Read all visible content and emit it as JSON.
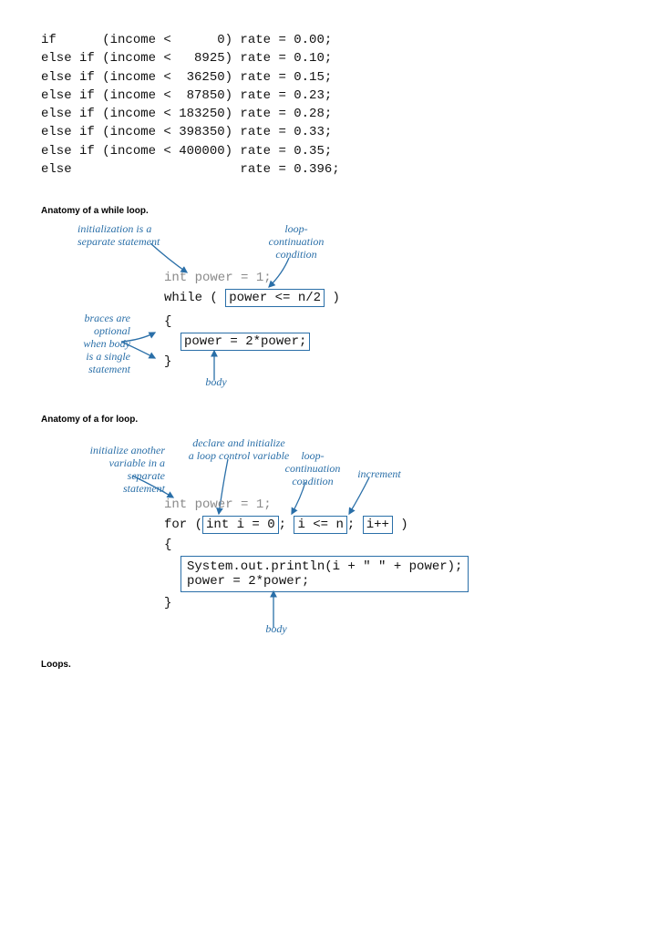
{
  "code_block": "if      (income <      0) rate = 0.00;\nelse if (income <   8925) rate = 0.10;\nelse if (income <  36250) rate = 0.15;\nelse if (income <  87850) rate = 0.23;\nelse if (income < 183250) rate = 0.28;\nelse if (income < 398350) rate = 0.33;\nelse if (income < 400000) rate = 0.35;\nelse                      rate = 0.396;",
  "captions": {
    "while": "Anatomy of a while loop.",
    "for": "Anatomy of a for loop.",
    "loops": "Loops."
  },
  "while": {
    "annot_init": "initialization is a\nseparate statement",
    "annot_cond": "loop-\ncontinuation\ncondition",
    "annot_braces": "braces are\noptional\nwhen body\nis a single\nstatement",
    "annot_body": "body",
    "gray_line": "int power = 1;",
    "head_left": "while ( ",
    "cond": "power <= n/2",
    "head_right": " )",
    "brace_open": "{",
    "body_stmt": "power = 2*power;",
    "brace_close": "}"
  },
  "for": {
    "annot_initvar": "initialize another\nvariable in a\nseparate\nstatement",
    "annot_declare": "declare and initialize\na loop control variable",
    "annot_cond": "loop-\ncontinuation\ncondition",
    "annot_incr": "increment",
    "annot_body": "body",
    "gray_line": "int power = 1;",
    "head_for": "for (",
    "init": "int i = 0",
    "sep1": "; ",
    "cond": "i <= n",
    "sep2": "; ",
    "incr": "i++",
    "head_right": " )",
    "brace_open": "{",
    "body_line1": "System.out.println(i + \" \" + power);",
    "body_line2": "power = 2*power;",
    "brace_close": "}"
  }
}
